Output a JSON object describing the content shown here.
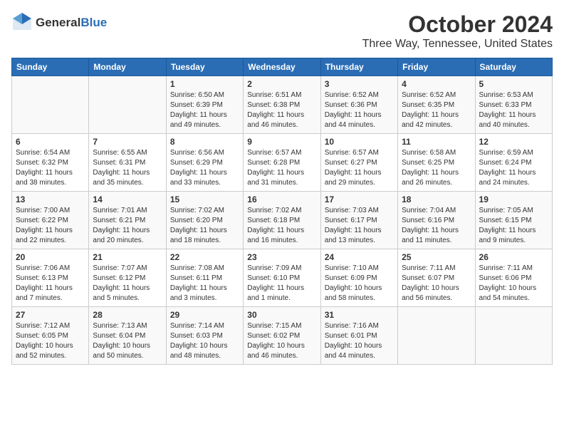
{
  "logo": {
    "general": "General",
    "blue": "Blue"
  },
  "title": "October 2024",
  "location": "Three Way, Tennessee, United States",
  "days_of_week": [
    "Sunday",
    "Monday",
    "Tuesday",
    "Wednesday",
    "Thursday",
    "Friday",
    "Saturday"
  ],
  "weeks": [
    [
      {
        "day": "",
        "info": ""
      },
      {
        "day": "",
        "info": ""
      },
      {
        "day": "1",
        "info": "Sunrise: 6:50 AM\nSunset: 6:39 PM\nDaylight: 11 hours and 49 minutes."
      },
      {
        "day": "2",
        "info": "Sunrise: 6:51 AM\nSunset: 6:38 PM\nDaylight: 11 hours and 46 minutes."
      },
      {
        "day": "3",
        "info": "Sunrise: 6:52 AM\nSunset: 6:36 PM\nDaylight: 11 hours and 44 minutes."
      },
      {
        "day": "4",
        "info": "Sunrise: 6:52 AM\nSunset: 6:35 PM\nDaylight: 11 hours and 42 minutes."
      },
      {
        "day": "5",
        "info": "Sunrise: 6:53 AM\nSunset: 6:33 PM\nDaylight: 11 hours and 40 minutes."
      }
    ],
    [
      {
        "day": "6",
        "info": "Sunrise: 6:54 AM\nSunset: 6:32 PM\nDaylight: 11 hours and 38 minutes."
      },
      {
        "day": "7",
        "info": "Sunrise: 6:55 AM\nSunset: 6:31 PM\nDaylight: 11 hours and 35 minutes."
      },
      {
        "day": "8",
        "info": "Sunrise: 6:56 AM\nSunset: 6:29 PM\nDaylight: 11 hours and 33 minutes."
      },
      {
        "day": "9",
        "info": "Sunrise: 6:57 AM\nSunset: 6:28 PM\nDaylight: 11 hours and 31 minutes."
      },
      {
        "day": "10",
        "info": "Sunrise: 6:57 AM\nSunset: 6:27 PM\nDaylight: 11 hours and 29 minutes."
      },
      {
        "day": "11",
        "info": "Sunrise: 6:58 AM\nSunset: 6:25 PM\nDaylight: 11 hours and 26 minutes."
      },
      {
        "day": "12",
        "info": "Sunrise: 6:59 AM\nSunset: 6:24 PM\nDaylight: 11 hours and 24 minutes."
      }
    ],
    [
      {
        "day": "13",
        "info": "Sunrise: 7:00 AM\nSunset: 6:22 PM\nDaylight: 11 hours and 22 minutes."
      },
      {
        "day": "14",
        "info": "Sunrise: 7:01 AM\nSunset: 6:21 PM\nDaylight: 11 hours and 20 minutes."
      },
      {
        "day": "15",
        "info": "Sunrise: 7:02 AM\nSunset: 6:20 PM\nDaylight: 11 hours and 18 minutes."
      },
      {
        "day": "16",
        "info": "Sunrise: 7:02 AM\nSunset: 6:18 PM\nDaylight: 11 hours and 16 minutes."
      },
      {
        "day": "17",
        "info": "Sunrise: 7:03 AM\nSunset: 6:17 PM\nDaylight: 11 hours and 13 minutes."
      },
      {
        "day": "18",
        "info": "Sunrise: 7:04 AM\nSunset: 6:16 PM\nDaylight: 11 hours and 11 minutes."
      },
      {
        "day": "19",
        "info": "Sunrise: 7:05 AM\nSunset: 6:15 PM\nDaylight: 11 hours and 9 minutes."
      }
    ],
    [
      {
        "day": "20",
        "info": "Sunrise: 7:06 AM\nSunset: 6:13 PM\nDaylight: 11 hours and 7 minutes."
      },
      {
        "day": "21",
        "info": "Sunrise: 7:07 AM\nSunset: 6:12 PM\nDaylight: 11 hours and 5 minutes."
      },
      {
        "day": "22",
        "info": "Sunrise: 7:08 AM\nSunset: 6:11 PM\nDaylight: 11 hours and 3 minutes."
      },
      {
        "day": "23",
        "info": "Sunrise: 7:09 AM\nSunset: 6:10 PM\nDaylight: 11 hours and 1 minute."
      },
      {
        "day": "24",
        "info": "Sunrise: 7:10 AM\nSunset: 6:09 PM\nDaylight: 10 hours and 58 minutes."
      },
      {
        "day": "25",
        "info": "Sunrise: 7:11 AM\nSunset: 6:07 PM\nDaylight: 10 hours and 56 minutes."
      },
      {
        "day": "26",
        "info": "Sunrise: 7:11 AM\nSunset: 6:06 PM\nDaylight: 10 hours and 54 minutes."
      }
    ],
    [
      {
        "day": "27",
        "info": "Sunrise: 7:12 AM\nSunset: 6:05 PM\nDaylight: 10 hours and 52 minutes."
      },
      {
        "day": "28",
        "info": "Sunrise: 7:13 AM\nSunset: 6:04 PM\nDaylight: 10 hours and 50 minutes."
      },
      {
        "day": "29",
        "info": "Sunrise: 7:14 AM\nSunset: 6:03 PM\nDaylight: 10 hours and 48 minutes."
      },
      {
        "day": "30",
        "info": "Sunrise: 7:15 AM\nSunset: 6:02 PM\nDaylight: 10 hours and 46 minutes."
      },
      {
        "day": "31",
        "info": "Sunrise: 7:16 AM\nSunset: 6:01 PM\nDaylight: 10 hours and 44 minutes."
      },
      {
        "day": "",
        "info": ""
      },
      {
        "day": "",
        "info": ""
      }
    ]
  ]
}
